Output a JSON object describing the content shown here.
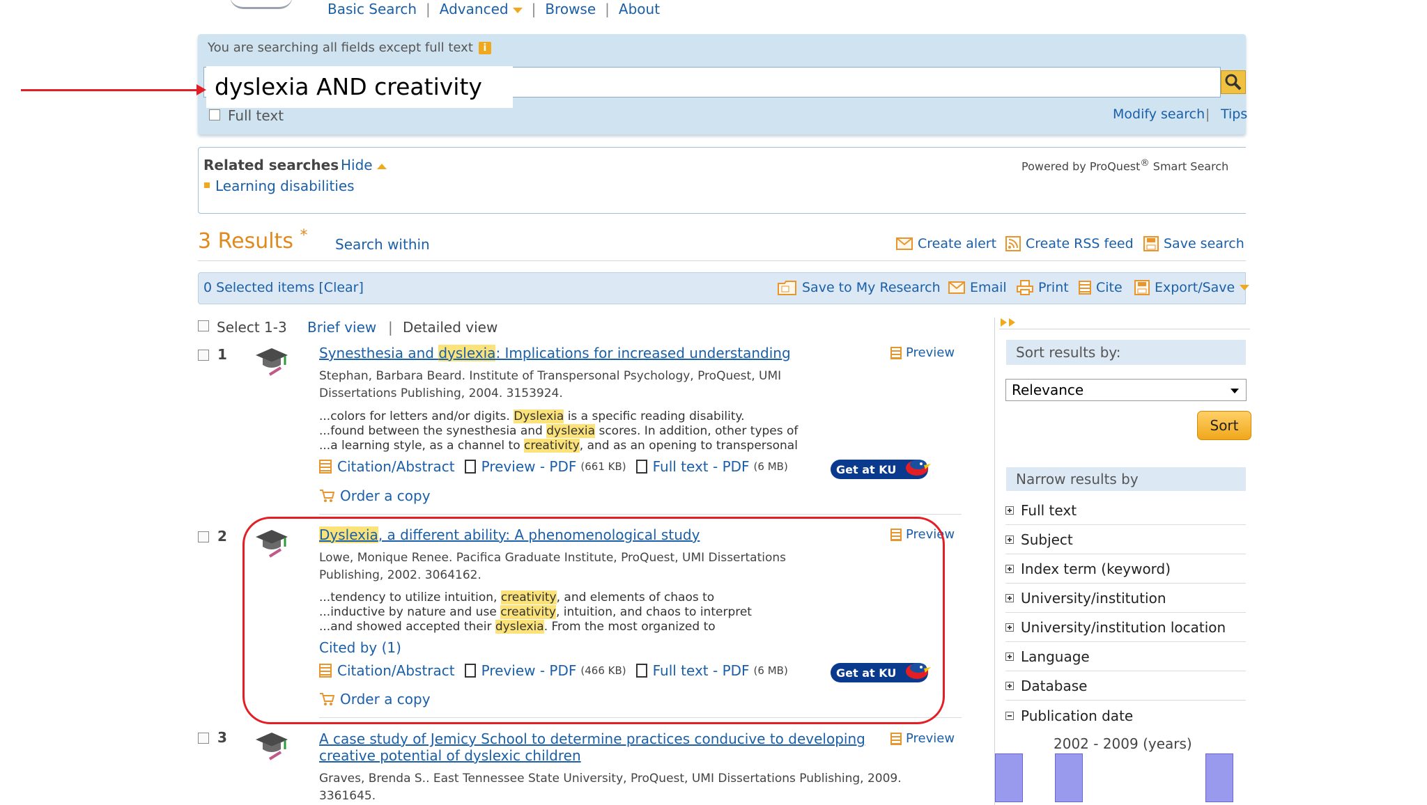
{
  "nav": {
    "basic": "Basic Search",
    "advanced": "Advanced",
    "browse": "Browse",
    "about": "About",
    "sep": "|"
  },
  "search": {
    "notice": "You are searching all fields except full text",
    "info_icon": "i",
    "query": "dyslexia AND creativity",
    "fulltext_label": "Full text",
    "modify": "Modify search",
    "tips_sep": "|",
    "tips": "Tips"
  },
  "related": {
    "title": "Related searches",
    "hide": "Hide",
    "item": "Learning disabilities",
    "powered": "Powered by ProQuest",
    "powered_reg": "®",
    "powered_tail": " Smart Search"
  },
  "results_header": {
    "count": "3 Results",
    "asterisk": "*",
    "search_within": "Search within",
    "create_alert": "Create alert",
    "rss": "Create RSS feed",
    "save_search": "Save search"
  },
  "selection_bar": {
    "selected": "0 Selected items [Clear]",
    "save_research": "Save to My Research",
    "email": "Email",
    "print": "Print",
    "cite": "Cite",
    "export": "Export/Save"
  },
  "list_controls": {
    "select_label": "Select 1-3",
    "brief": "Brief view",
    "sep": "|",
    "detailed": "Detailed view"
  },
  "results": [
    {
      "num": "1",
      "title_parts": [
        "Synesthesia and ",
        "dyslexia",
        ": Implications for increased understanding"
      ],
      "meta_line1": "Stephan, Barbara Beard. Institute of Transpersonal Psychology, ProQuest, UMI",
      "meta_line2": "Dissertations Publishing, 2004. 3153924.",
      "snip1": [
        "...colors for letters and/or digits. ",
        "Dyslexia",
        " is a specific reading disability."
      ],
      "snip2": [
        "...found between the synesthesia and ",
        "dyslexia",
        " scores. In addition, other types of"
      ],
      "snip3": [
        "...a learning style, as a channel to ",
        "creativity",
        ", and as an opening to transpersonal"
      ],
      "preview": "Preview"
    },
    {
      "num": "2",
      "title_parts": [
        "Dyslexia",
        ", a different ability: A phenomenological study"
      ],
      "meta_line1": "Lowe, Monique Renee. Pacifica Graduate Institute, ProQuest, UMI Dissertations",
      "meta_line2": "Publishing, 2002. 3064162.",
      "snip1": [
        "...tendency to utilize intuition, ",
        "creativity",
        ", and elements of chaos to"
      ],
      "snip2": [
        "...inductive by nature and use ",
        "creativity",
        ", intuition, and chaos to interpret"
      ],
      "snip3": [
        "...and showed accepted their ",
        "dyslexia",
        ". From the most organized to"
      ],
      "cited_by": "Cited by (1)",
      "preview": "Preview"
    },
    {
      "num": "3",
      "title_line1": "A case study of Jemicy School to determine practices conducive to developing",
      "title_line2": "creative potential of dyslexic children",
      "meta_line1": "Graves, Brenda S.. East Tennessee State University, ProQuest, UMI Dissertations Publishing, 2009.",
      "meta_line2": "3361645.",
      "preview": "Preview"
    }
  ],
  "links": {
    "citation": "Citation/Abstract",
    "preview_pdf": "Preview - PDF",
    "full_pdf": "Full text - PDF",
    "size_r1": "(661 KB)",
    "size_r2": "(466 KB)",
    "full_size": "(6 MB)",
    "getku": "Get at KU",
    "order": "Order a copy"
  },
  "sidebar": {
    "sort_head": "Sort results by:",
    "sort_value": "Relevance",
    "sort_button": "Sort",
    "narrow_head": "Narrow results by",
    "facets": [
      "Full text",
      "Subject",
      "Index term (keyword)",
      "University/institution",
      "University/institution location",
      "Language",
      "Database",
      "Publication date"
    ],
    "pub_range": "2002 - 2009 (years)"
  },
  "colors": {
    "accent_link": "#1a5fa8",
    "highlight": "#fbe37a",
    "annotation_red": "#e31e24",
    "results_count": "#e08a1e"
  }
}
